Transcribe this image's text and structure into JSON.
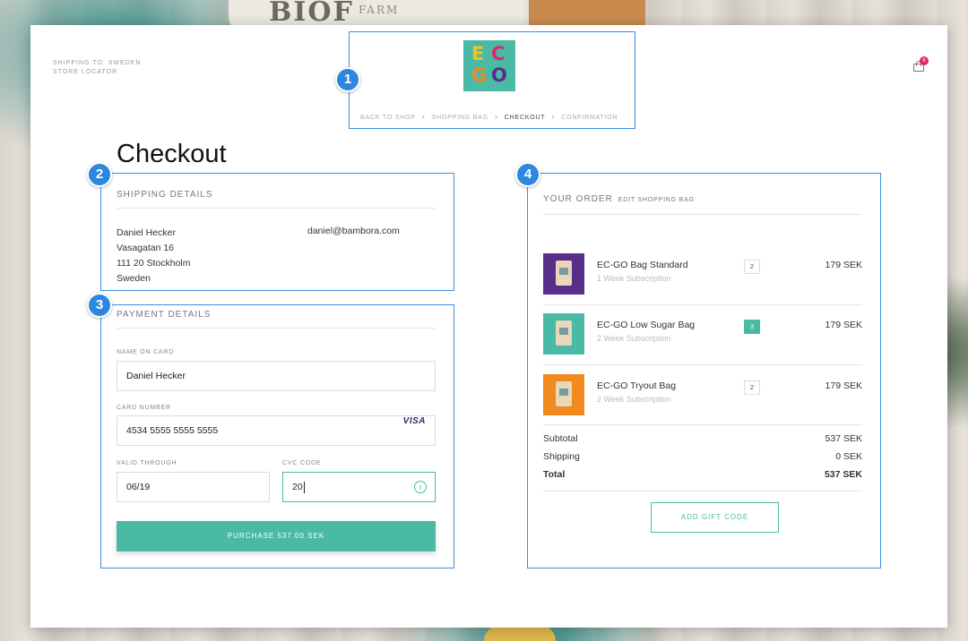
{
  "background": {
    "jar_text": "BIOF",
    "jar_subtext": "FARM"
  },
  "header": {
    "shipping_to": "SHIPPING TO: SWEDEN",
    "store_locator": "STORE LOCATOR",
    "cart_count": "6",
    "logo": [
      "E",
      "C",
      "G",
      "O"
    ],
    "breadcrumb": [
      {
        "label": "BACK TO SHOP",
        "active": false
      },
      {
        "label": "SHOPPING BAG",
        "active": false
      },
      {
        "label": "CHECKOUT",
        "active": true
      },
      {
        "label": "CONFIRMATION",
        "active": false
      }
    ],
    "separator": "›"
  },
  "page_title": "Checkout",
  "shipping": {
    "title": "SHIPPING DETAILS",
    "name": "Daniel Hecker",
    "street": "Vasagatan 16",
    "city": "111 20 Stockholm",
    "country": "Sweden",
    "email": "daniel@bambora.com"
  },
  "payment": {
    "title": "PAYMENT DETAILS",
    "name_label": "NAME ON CARD",
    "name_value": "Daniel Hecker",
    "card_label": "CARD NUMBER",
    "card_value": "4534 5555 5555 5555",
    "card_brand": "VISA",
    "valid_label": "VALID THROUGH",
    "valid_value": "06/19",
    "cvc_label": "CVC CODE",
    "cvc_value": "20",
    "info_icon": "i",
    "purchase_label": "PURCHASE 537.00 SEK"
  },
  "order": {
    "title": "YOUR ORDER",
    "edit_link": "EDIT SHOPPING BAG",
    "items": [
      {
        "name": "EC-GO Bag Standard",
        "sub": "1 Week Subscription",
        "qty": "2",
        "price": "179 SEK",
        "color": "#5a2d8a",
        "selected": false
      },
      {
        "name": "EC-GO Low Sugar Bag",
        "sub": "2 Week Subscription",
        "qty": "3",
        "price": "179 SEK",
        "color": "#4ab9a6",
        "selected": true
      },
      {
        "name": "EC-GO Tryout Bag",
        "sub": "2 Week Subscription",
        "qty": "2",
        "price": "179 SEK",
        "color": "#f08a1c",
        "selected": false
      }
    ],
    "subtotal_label": "Subtotal",
    "subtotal_value": "537 SEK",
    "shipping_label": "Shipping",
    "shipping_value": "0 SEK",
    "total_label": "Total",
    "total_value": "537 SEK",
    "gift_label": "ADD GIFT CODE"
  },
  "annotations": [
    "1",
    "2",
    "3",
    "4"
  ],
  "colors": {
    "accent": "#4ab9a6",
    "highlight": "#3a8fe0",
    "marker": "#2e86de",
    "badge": "#e0276a"
  }
}
